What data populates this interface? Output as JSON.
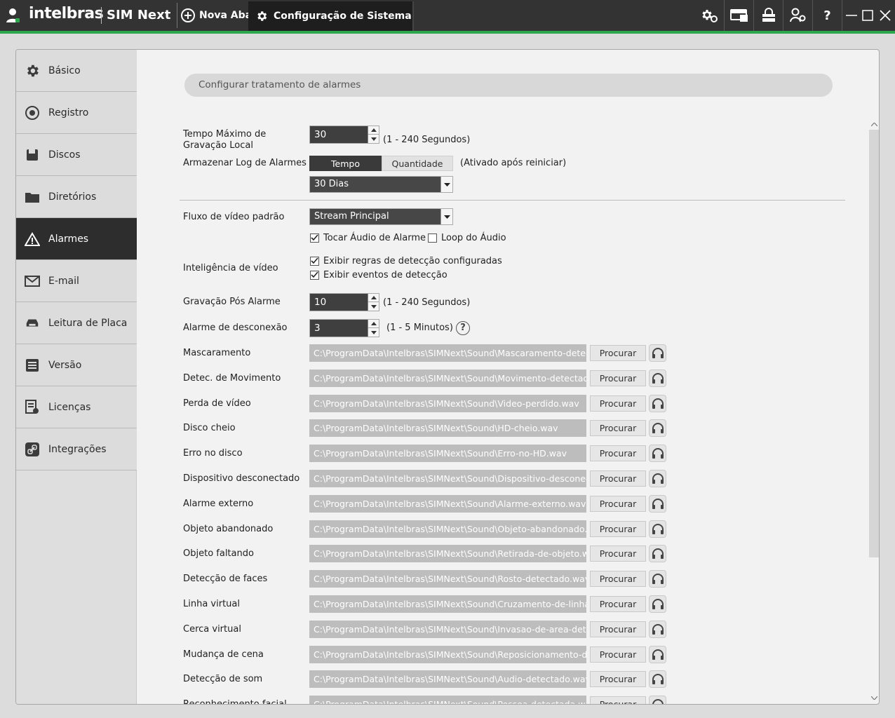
{
  "titlebar": {
    "brand": "intelbras",
    "product": "SIM Next",
    "tabs": [
      {
        "label": "Nova Aba",
        "icon": "plus-circle-icon"
      },
      {
        "label": "Configuração de Sistema",
        "icon": "gear-icon"
      }
    ],
    "toolbar_icons": [
      "settings-gear-icon",
      "display-wall-icon",
      "lock-icon",
      "user-settings-icon",
      "help-icon"
    ],
    "window_controls": [
      "minimize-icon",
      "maximize-icon",
      "close-icon"
    ]
  },
  "sidebar": {
    "items": [
      {
        "label": "Básico",
        "icon": "gear-icon",
        "active": false
      },
      {
        "label": "Registro",
        "icon": "record-icon",
        "active": false
      },
      {
        "label": "Discos",
        "icon": "disk-icon",
        "active": false
      },
      {
        "label": "Diretórios",
        "icon": "folder-icon",
        "active": false
      },
      {
        "label": "Alarmes",
        "icon": "warning-icon",
        "active": true
      },
      {
        "label": "E-mail",
        "icon": "mail-icon",
        "active": false
      },
      {
        "label": "Leitura de Placa",
        "icon": "car-icon",
        "active": false
      },
      {
        "label": "Versão",
        "icon": "list-icon",
        "active": false
      },
      {
        "label": "Licenças",
        "icon": "license-icon",
        "active": false
      },
      {
        "label": "Integrações",
        "icon": "link-icon",
        "active": false
      }
    ]
  },
  "section_title": "Configurar tratamento de alarmes",
  "form": {
    "max_rec_label": "Tempo Máximo de Gravação Local",
    "max_rec_value": "30",
    "max_rec_hint": "(1 - 240 Segundos)",
    "log_label": "Armazenar Log de Alarmes",
    "log_mode_on": "Tempo",
    "log_mode_off": "Quantidade",
    "log_hint": "(Ativado após reiniciar)",
    "log_period": "30 Dias",
    "stream_label": "Fluxo de vídeo padrão",
    "stream_value": "Stream Principal",
    "play_audio_label": "Tocar Áudio de Alarme",
    "play_audio_checked": true,
    "loop_audio_label": "Loop do Áudio",
    "loop_audio_checked": false,
    "vi_label": "Inteligência de vídeo",
    "vi_rules_label": "Exibir regras de detecção configuradas",
    "vi_rules_checked": true,
    "vi_events_label": "Exibir eventos de detecção",
    "vi_events_checked": true,
    "post_rec_label": "Gravação Pós Alarme",
    "post_rec_value": "10",
    "post_rec_hint": "(1 - 240 Segundos)",
    "disc_label": "Alarme de desconexão",
    "disc_value": "3",
    "disc_hint": "(1 - 5 Minutos)",
    "help_glyph": "?"
  },
  "browse_label": "Procurar",
  "sounds": [
    {
      "label": "Mascaramento",
      "path": "C:\\ProgramData\\Intelbras\\SIMNext\\Sound\\Mascaramento-detectad"
    },
    {
      "label": "Detec. de Movimento",
      "path": "C:\\ProgramData\\Intelbras\\SIMNext\\Sound\\Movimento-detectado.w"
    },
    {
      "label": "Perda de vídeo",
      "path": "C:\\ProgramData\\Intelbras\\SIMNext\\Sound\\Video-perdido.wav"
    },
    {
      "label": "Disco cheio",
      "path": "C:\\ProgramData\\Intelbras\\SIMNext\\Sound\\HD-cheio.wav"
    },
    {
      "label": "Erro no disco",
      "path": "C:\\ProgramData\\Intelbras\\SIMNext\\Sound\\Erro-no-HD.wav"
    },
    {
      "label": "Dispositivo desconectado",
      "path": "C:\\ProgramData\\Intelbras\\SIMNext\\Sound\\Dispositivo-desconectad"
    },
    {
      "label": "Alarme externo",
      "path": "C:\\ProgramData\\Intelbras\\SIMNext\\Sound\\Alarme-externo.wav"
    },
    {
      "label": "Objeto abandonado",
      "path": "C:\\ProgramData\\Intelbras\\SIMNext\\Sound\\Objeto-abandonado.wav"
    },
    {
      "label": "Objeto faltando",
      "path": "C:\\ProgramData\\Intelbras\\SIMNext\\Sound\\Retirada-de-objeto.wav"
    },
    {
      "label": "Detecção de faces",
      "path": "C:\\ProgramData\\Intelbras\\SIMNext\\Sound\\Rosto-detectado.wav"
    },
    {
      "label": "Linha virtual",
      "path": "C:\\ProgramData\\Intelbras\\SIMNext\\Sound\\Cruzamento-de-linha-de"
    },
    {
      "label": "Cerca virtual",
      "path": "C:\\ProgramData\\Intelbras\\SIMNext\\Sound\\Invasao-de-area-detecta"
    },
    {
      "label": "Mudança de cena",
      "path": "C:\\ProgramData\\Intelbras\\SIMNext\\Sound\\Reposicionamento-de-ca"
    },
    {
      "label": "Detecção de som",
      "path": "C:\\ProgramData\\Intelbras\\SIMNext\\Sound\\Audio-detectado.wav"
    },
    {
      "label": "Reconhecimento facial",
      "path": "C:\\ProgramData\\Intelbras\\SIMNext\\Sound\\Pessoa-detectada.wav"
    }
  ],
  "colors": {
    "titlebar_bg": "#333333",
    "accent_green": "#2ea84f",
    "sidebar_active_bg": "#2d2d2d",
    "input_bg": "#3f3f3f",
    "path_bg": "#bdbdbd"
  }
}
